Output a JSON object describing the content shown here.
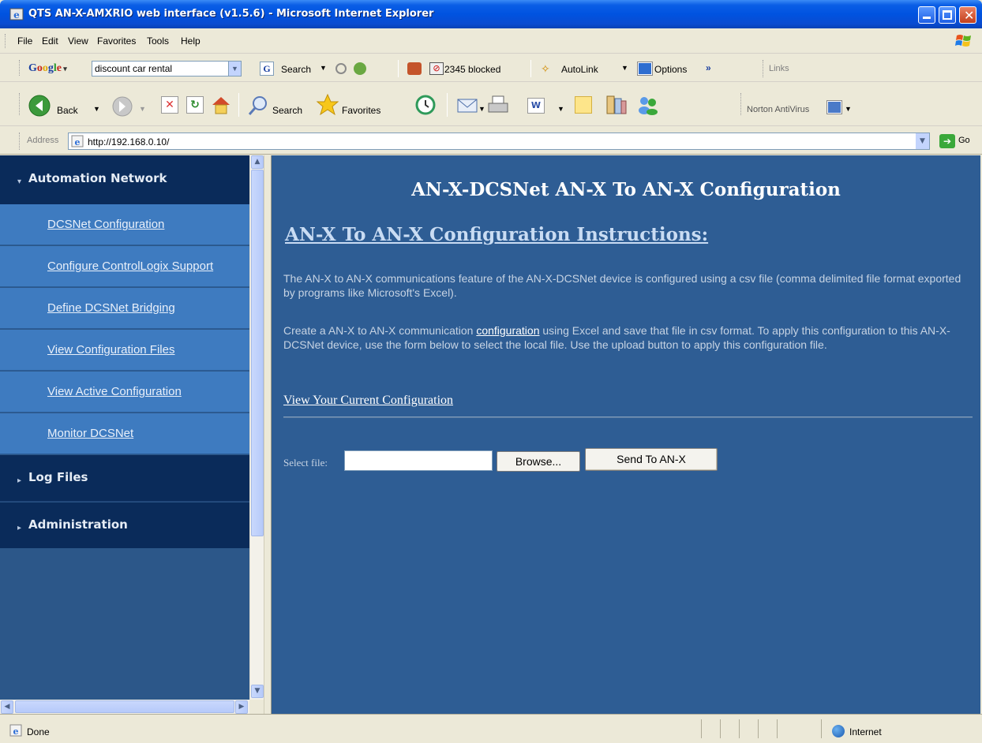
{
  "window": {
    "title": "QTS AN-X-AMXRIO web interface (v1.5.6) - Microsoft Internet Explorer"
  },
  "menu": [
    "File",
    "Edit",
    "View",
    "Favorites",
    "Tools",
    "Help"
  ],
  "google_toolbar": {
    "brand": "Google",
    "search_value": "discount car rental",
    "search_label": "Search",
    "blocked_label": "2345 blocked",
    "autolink_label": "AutoLink",
    "options_label": "Options",
    "more": "»",
    "links_label": "Links"
  },
  "std_toolbar": {
    "back_label": "Back",
    "search_label": "Search",
    "favorites_label": "Favorites",
    "norton_label": "Norton AntiVirus"
  },
  "address": {
    "label": "Address",
    "url": "http://192.168.0.10/",
    "go_label": "Go"
  },
  "sidebar": {
    "sections": [
      {
        "label": "Automation Network",
        "expanded": true
      },
      {
        "label": "Log Files",
        "expanded": false
      },
      {
        "label": "Administration",
        "expanded": false
      }
    ],
    "links": [
      "DCSNet Configuration",
      "Configure ControlLogix Support",
      "Define DCSNet Bridging",
      "View Configuration Files",
      "View Active Configuration",
      "Monitor DCSNet"
    ]
  },
  "main": {
    "heading": "AN-X-DCSNet AN-X To AN-X Configuration",
    "subheading": "AN-X To AN-X Configuration Instructions:",
    "para1": "The AN-X to AN-X communications feature of the AN-X-DCSNet device is configured using a csv file (comma delimited file format exported by programs like Microsoft's Excel).",
    "para2_before": "Create a AN-X to AN-X communication ",
    "para2_link": "configuration",
    "para2_after": " using Excel and save that file in csv format. To apply this configuration to this AN-X-DCSNet device, use the form below to select the local file. Use the upload button to apply this configuration file.",
    "view_link": "View Your Current Configuration",
    "select_file_label": "Select file:",
    "file_value": "",
    "browse_label": "Browse...",
    "send_label": "Send To AN-X"
  },
  "status": {
    "text": "Done",
    "zone": "Internet"
  },
  "colors": {
    "main_bg": "#2e5d94",
    "sidebar_section_bg": "#0a2b5a",
    "sidebar_link_bg": "#3e7bc0",
    "titlebar": "#0053e0"
  }
}
